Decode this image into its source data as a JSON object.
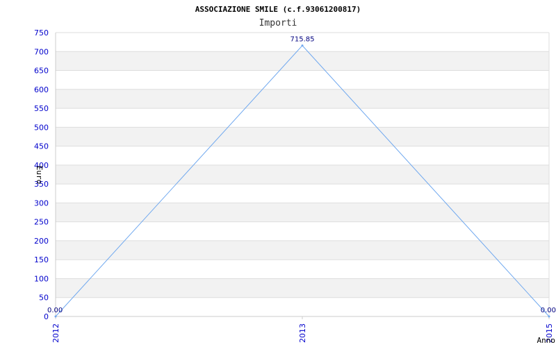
{
  "chart_data": {
    "type": "line",
    "title": "ASSOCIAZIONE SMILE (c.f.93061200817)",
    "subtitle": "Importi",
    "xlabel": "Anno",
    "ylabel": "Euro",
    "categories": [
      "2012",
      "2013",
      "2015"
    ],
    "series": [
      {
        "values": [
          0.0,
          715.85,
          0.0
        ],
        "data_labels": [
          "0.00",
          "715.85",
          "0.00"
        ]
      }
    ],
    "ylim": [
      0,
      750
    ],
    "y_ticks": [
      0,
      50,
      100,
      150,
      200,
      250,
      300,
      350,
      400,
      450,
      500,
      550,
      600,
      650,
      700,
      750
    ],
    "grid": true,
    "legend": "none"
  },
  "colors": {
    "line": "#6fa8ef",
    "band_alt": "#f2f2f2",
    "band_base": "#ffffff",
    "grid_line": "#dddddd",
    "tick_text": "#0000cc",
    "data_label_text": "#000080"
  }
}
